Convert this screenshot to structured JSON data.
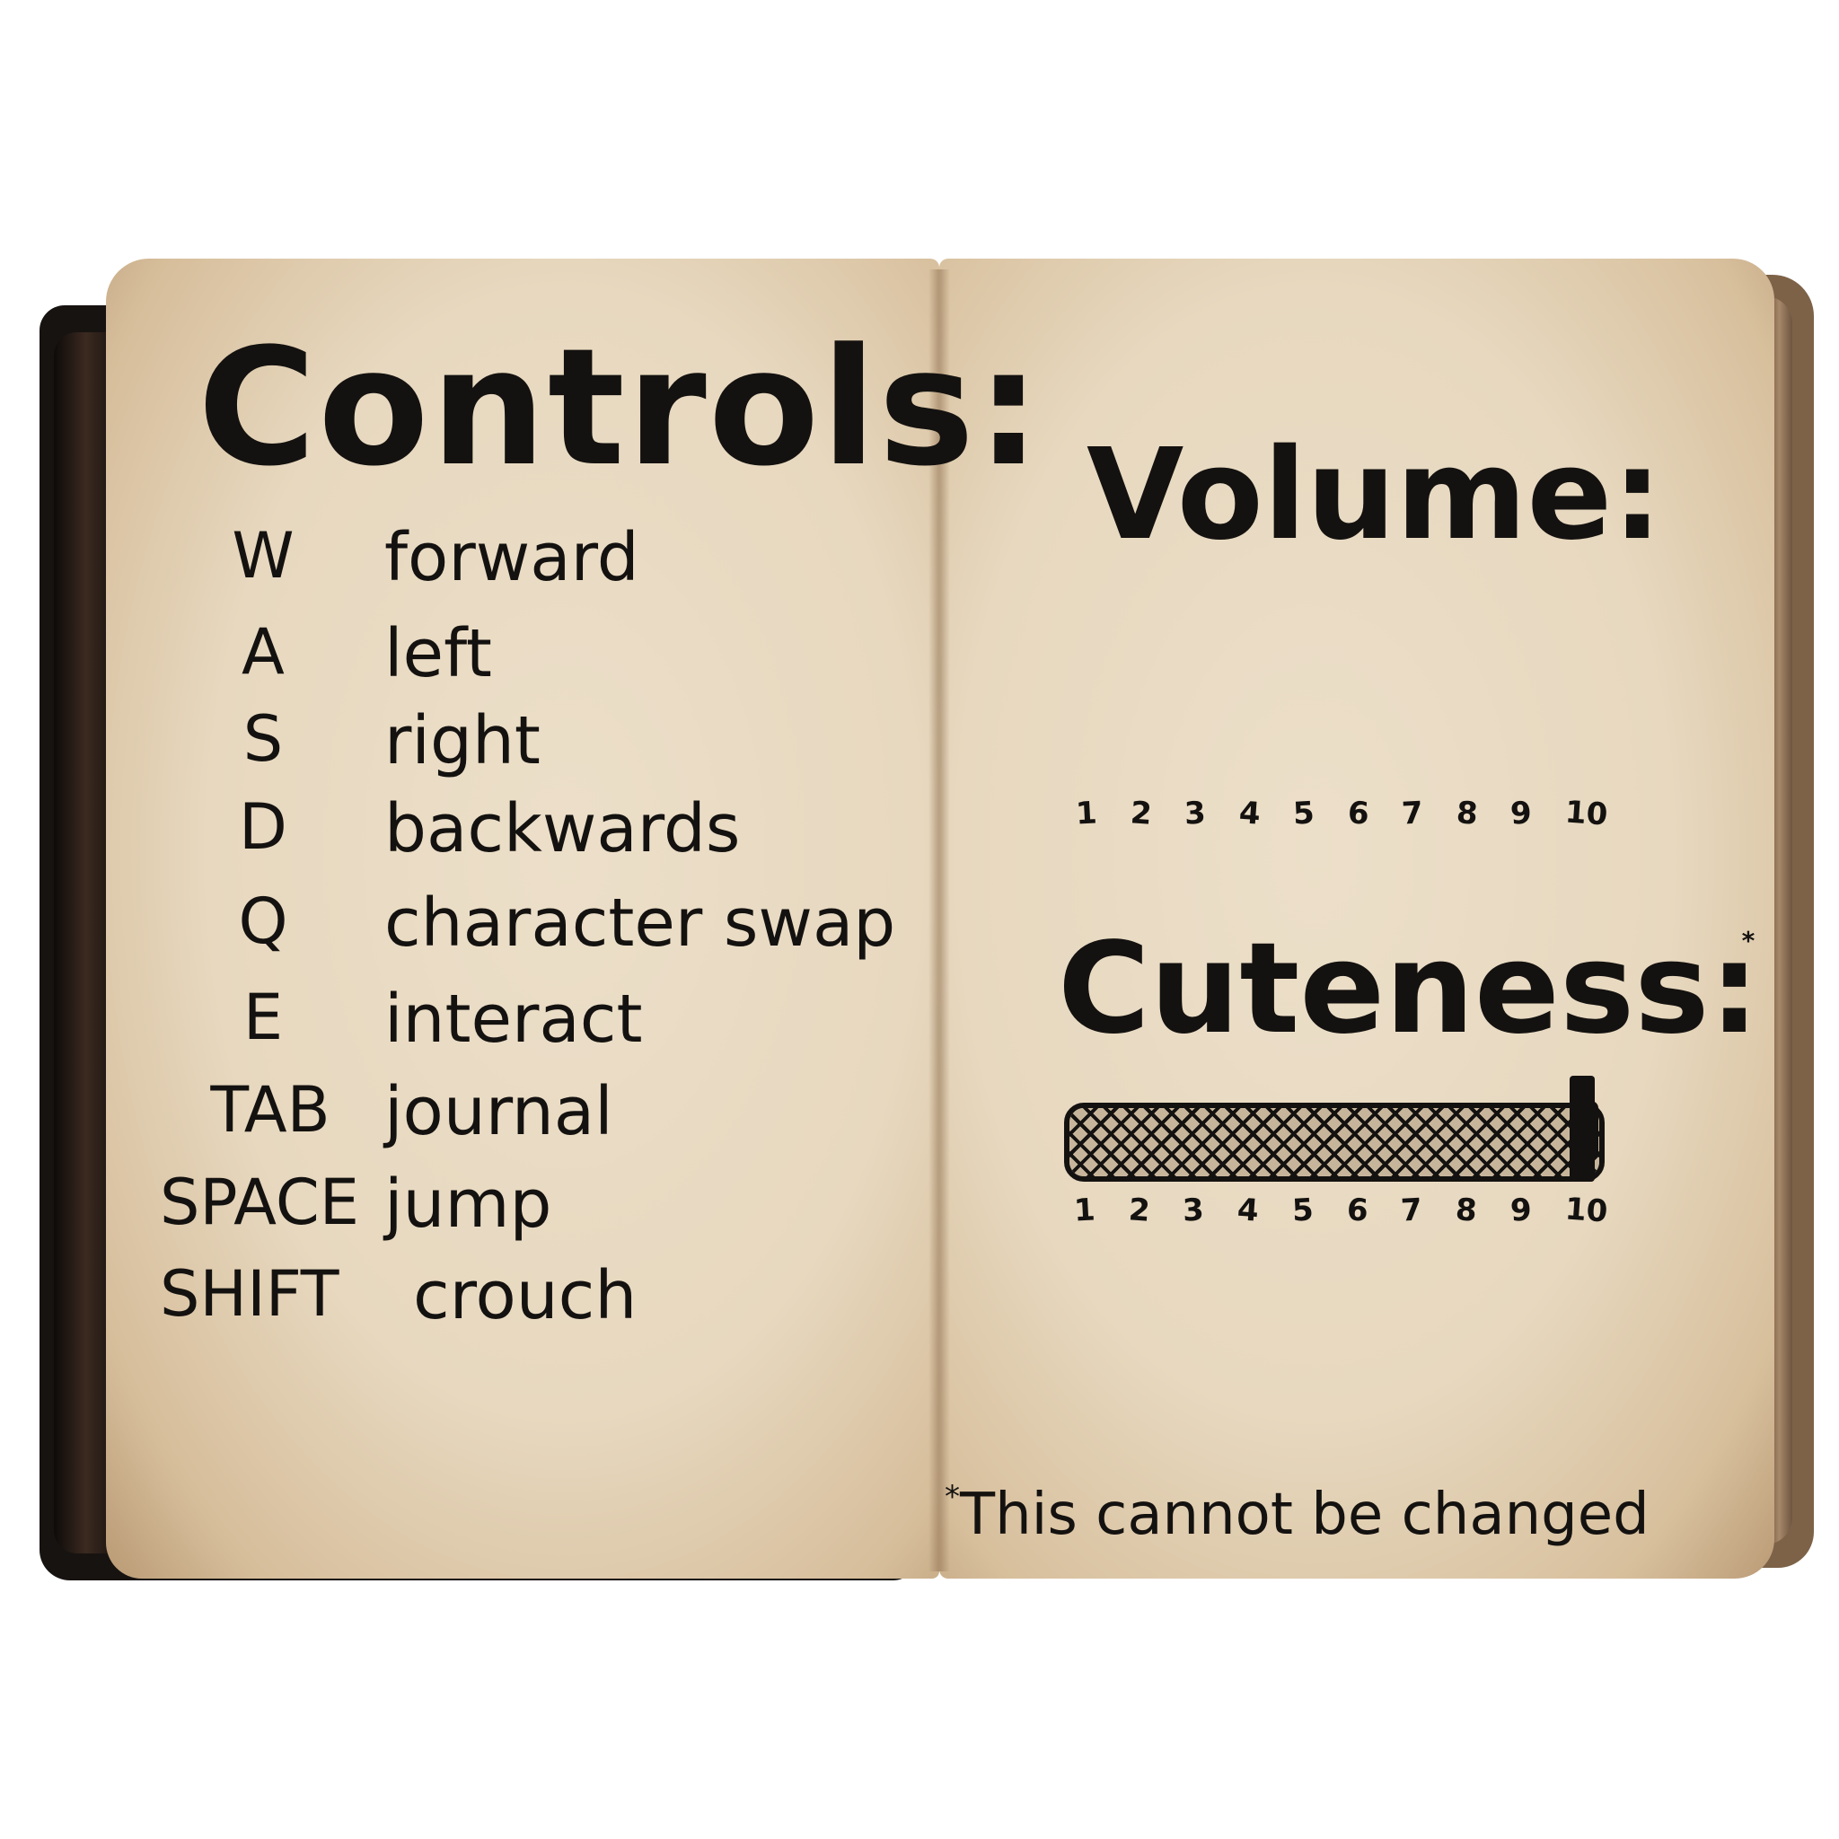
{
  "controls": {
    "title": "Controls:",
    "rows": [
      {
        "key": "W",
        "action": "forward"
      },
      {
        "key": "A",
        "action": "left"
      },
      {
        "key": "S",
        "action": "right"
      },
      {
        "key": "D",
        "action": "backwards"
      },
      {
        "key": "Q",
        "action": "character swap"
      },
      {
        "key": "E",
        "action": "interact"
      },
      {
        "key": "TAB",
        "action": "journal"
      },
      {
        "key": "SPACE",
        "action": "jump"
      },
      {
        "key": "SHIFT",
        "action": "crouch"
      }
    ]
  },
  "volume": {
    "title": "Volume:",
    "scale": [
      "1",
      "2",
      "3",
      "4",
      "5",
      "6",
      "7",
      "8",
      "9",
      "10"
    ]
  },
  "cuteness": {
    "title": "Cuteness:",
    "asterisk": "*",
    "scale": [
      "1",
      "2",
      "3",
      "4",
      "5",
      "6",
      "7",
      "8",
      "9",
      "10"
    ],
    "level": 10,
    "max": 10
  },
  "footnote": {
    "asterisk": "*",
    "text": "This cannot be changed"
  },
  "colors": {
    "ink": "#141210",
    "paper": "#e9dbc3",
    "cover": "#171311"
  }
}
